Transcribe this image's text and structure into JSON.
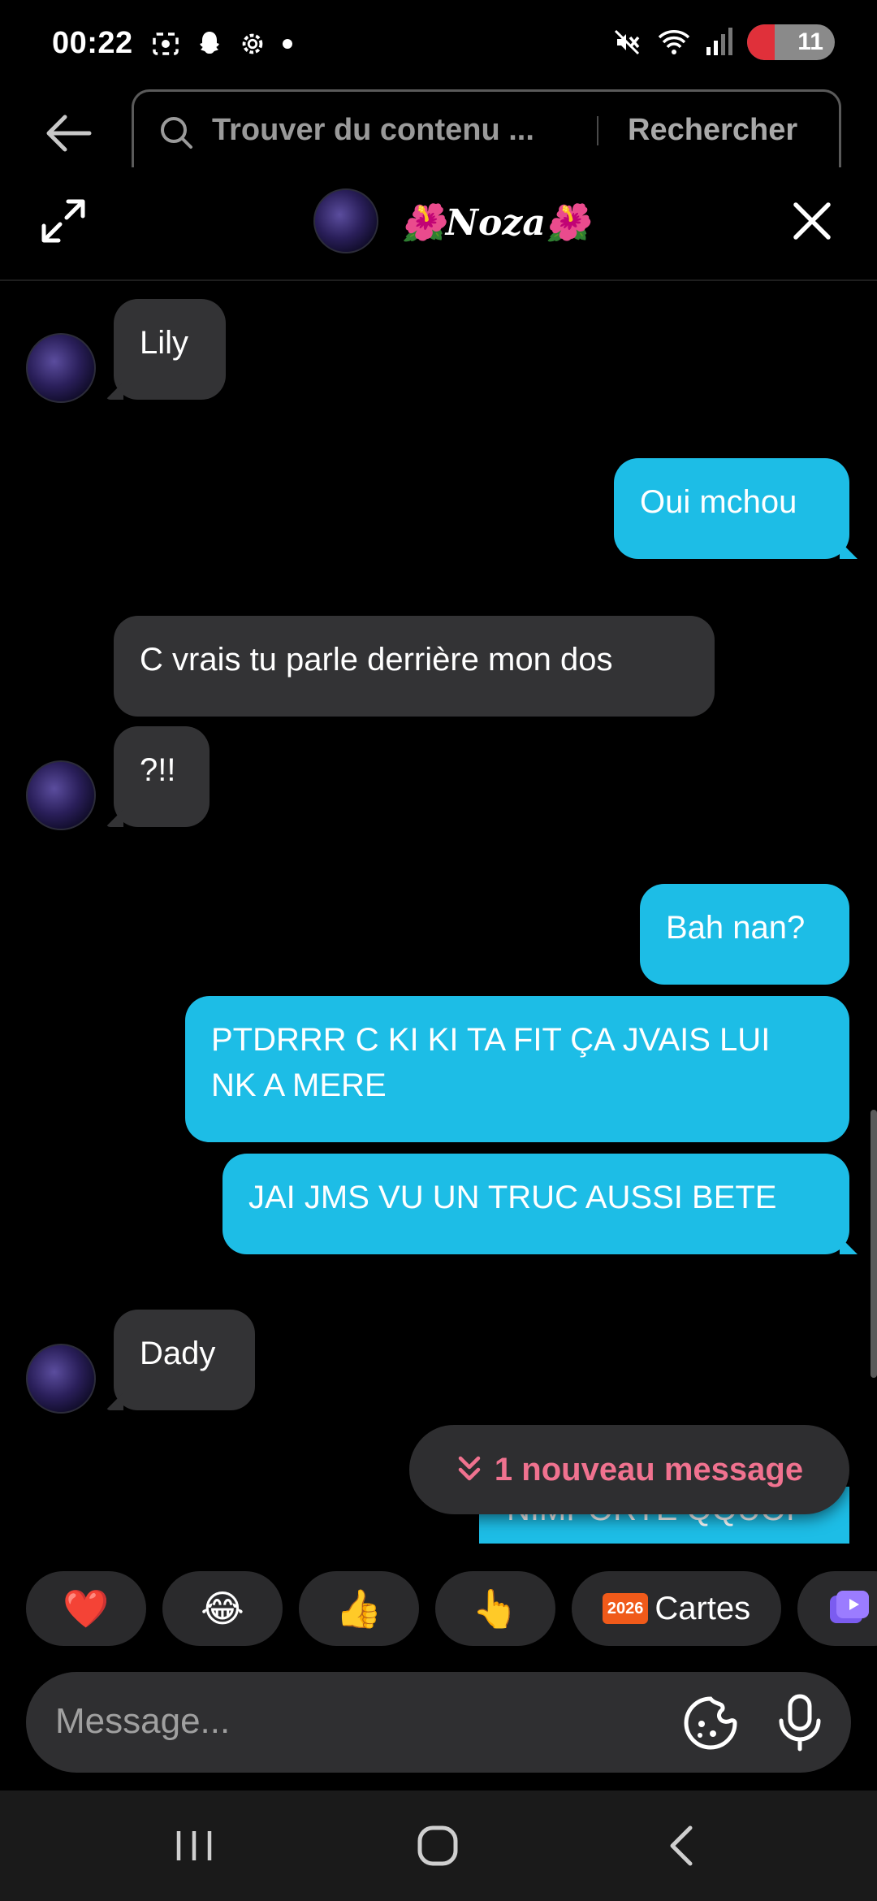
{
  "status_bar": {
    "time": "00:22",
    "battery": "11",
    "icons": [
      "screen-record-icon",
      "snapchat-icon",
      "settings-icon",
      "dot-icon",
      "mute-icon",
      "wifi-icon",
      "signal-icon"
    ]
  },
  "search": {
    "placeholder": "Trouver du contenu ...",
    "button_label": "Rechercher"
  },
  "chat": {
    "contact_name": "🌺Noza🌺"
  },
  "messages": [
    {
      "side": "in",
      "text": "Lily"
    },
    {
      "side": "out",
      "text": "Oui mchou"
    },
    {
      "side": "in",
      "text": "C vrais tu parle derrière mon dos"
    },
    {
      "side": "in",
      "text": "?!!"
    },
    {
      "side": "out",
      "text": "Bah nan?"
    },
    {
      "side": "out",
      "text": "PTDRRR C KI KI TA FIT ÇA JVAIS LUI NK A MERE"
    },
    {
      "side": "out",
      "text": "JAI JMS VU UN TRUC AUSSI BETE"
    },
    {
      "side": "in",
      "text": "Dady"
    },
    {
      "side": "out",
      "text": "NIMPORTE QQUOI"
    }
  ],
  "new_message_pill": "1 nouveau message",
  "reactions": [
    {
      "emoji": "❤️",
      "icon": "heart-icon"
    },
    {
      "emoji": "😂",
      "icon": "laughing-icon"
    },
    {
      "emoji": "👍",
      "icon": "thumbs-up-icon"
    },
    {
      "emoji": "👆",
      "icon": "pointing-up-icon"
    },
    {
      "badge": "2026",
      "label": "Cartes",
      "icon": "calendar-icon"
    }
  ],
  "composer": {
    "placeholder": "Message..."
  },
  "colors": {
    "outgoing_bubble": "#1dbde6",
    "incoming_bubble": "#333335",
    "accent_pink": "#f0728f"
  }
}
